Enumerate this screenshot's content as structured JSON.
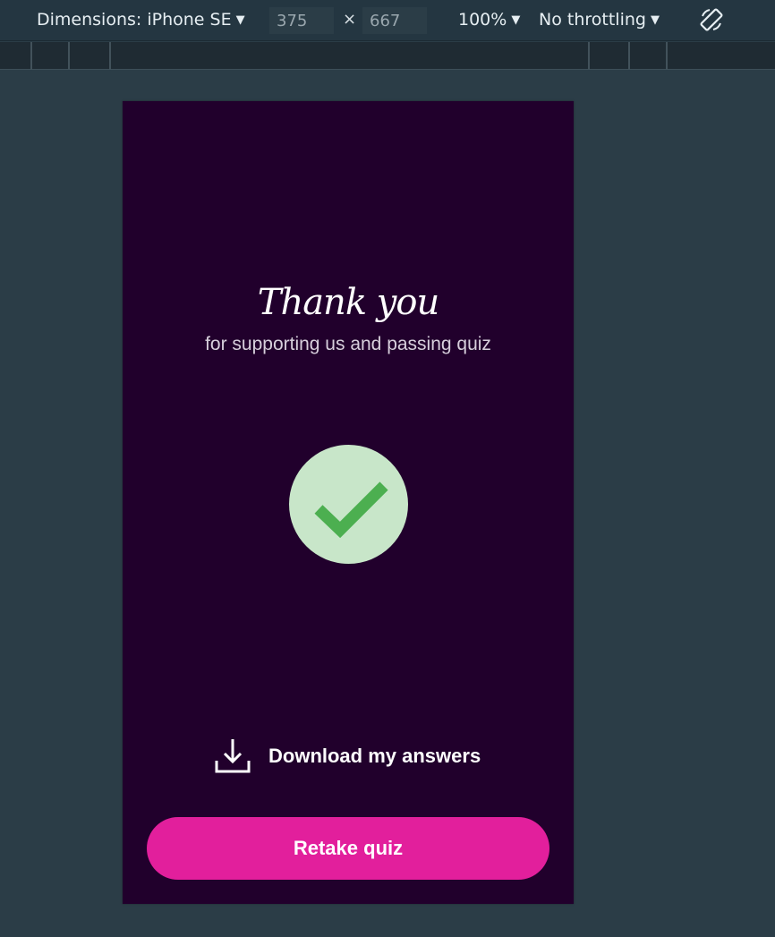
{
  "devtools": {
    "device_label": "Dimensions: iPhone SE",
    "width_value": "375",
    "height_value": "667",
    "times_symbol": "×",
    "zoom_label": "100%",
    "throttling_label": "No throttling",
    "caret": "▼",
    "icons": {
      "dropdown": "chevron-down-icon",
      "rotate": "rotate-icon"
    }
  },
  "page": {
    "title": "Thank you",
    "subtitle": "for supporting us and passing quiz",
    "success_icon": "checkmark-icon",
    "download_icon": "download-icon",
    "download_label": "Download my answers",
    "retake_label": "Retake quiz"
  },
  "colors": {
    "page_background": "#21002c",
    "accent": "#e21f9c",
    "success_circle": "#c8e6c9",
    "success_check": "#4caf50",
    "devtools_bg": "#243641",
    "canvas_bg": "#2b3d47"
  }
}
